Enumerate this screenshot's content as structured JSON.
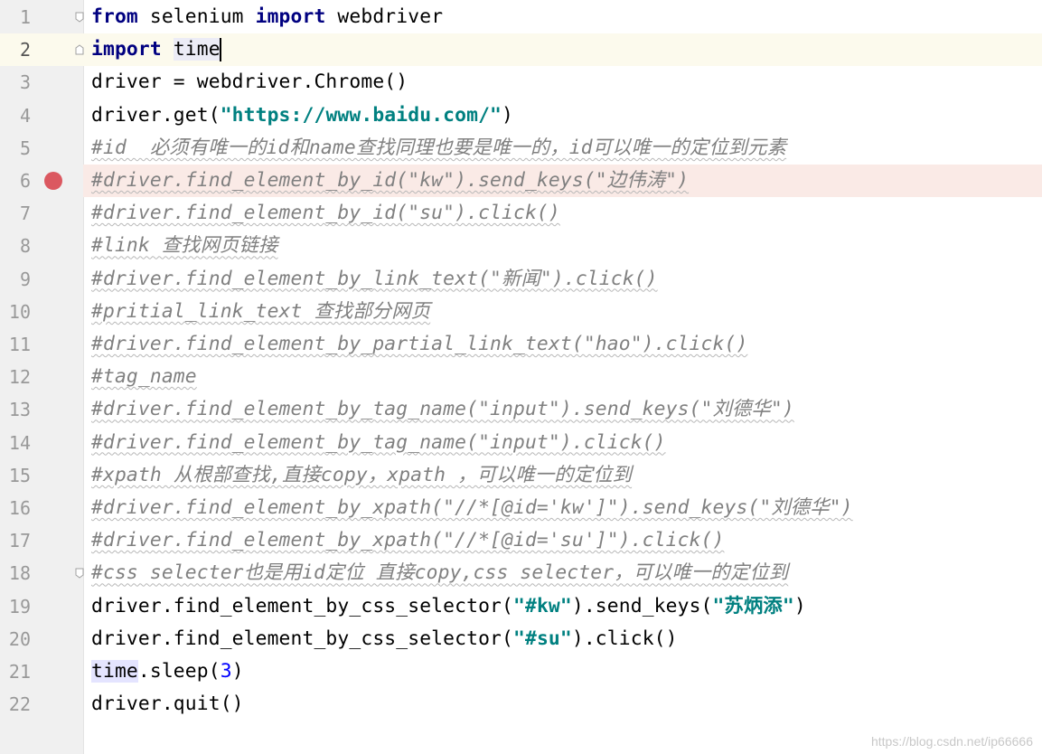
{
  "editor": {
    "current_line": 2,
    "breakpoint_line": 6,
    "lines": [
      {
        "num": "1",
        "parts": [
          [
            "kw",
            "from"
          ],
          [
            "p",
            " selenium "
          ],
          [
            "kw",
            "import"
          ],
          [
            "p",
            " webdriver"
          ]
        ]
      },
      {
        "num": "2",
        "parts": [
          [
            "kw",
            "import"
          ],
          [
            "p",
            " "
          ],
          [
            "hl2",
            "time"
          ],
          [
            "caret",
            ""
          ]
        ]
      },
      {
        "num": "3",
        "parts": [
          [
            "p",
            "driver = webdriver.Chrome()"
          ]
        ]
      },
      {
        "num": "4",
        "parts": [
          [
            "p",
            "driver.get("
          ],
          [
            "str",
            "\"https://www.baidu.com/\""
          ],
          [
            "p",
            ")"
          ]
        ]
      },
      {
        "num": "5",
        "parts": [
          [
            "cmt",
            "#id  必须有唯一的id和name查找同理也要是唯一的，id可以唯一的定位到元素"
          ]
        ]
      },
      {
        "num": "6",
        "parts": [
          [
            "cmt",
            "#driver.find_element_by_id(\"kw\").send_keys(\"边伟涛\")"
          ]
        ]
      },
      {
        "num": "7",
        "parts": [
          [
            "cmt",
            "#driver.find_element_by_id(\"su\").click()"
          ]
        ]
      },
      {
        "num": "8",
        "parts": [
          [
            "cmt",
            "#link 查找网页链接"
          ]
        ]
      },
      {
        "num": "9",
        "parts": [
          [
            "cmt",
            "#driver.find_element_by_link_text(\"新闻\").click()"
          ]
        ]
      },
      {
        "num": "10",
        "parts": [
          [
            "cmt",
            "#pritial_link_text 查找部分网页"
          ]
        ]
      },
      {
        "num": "11",
        "parts": [
          [
            "cmt",
            "#driver.find_element_by_partial_link_text(\"hao\").click()"
          ]
        ]
      },
      {
        "num": "12",
        "parts": [
          [
            "cmt",
            "#tag_name"
          ]
        ]
      },
      {
        "num": "13",
        "parts": [
          [
            "cmt",
            "#driver.find_element_by_tag_name(\"input\").send_keys(\"刘德华\")"
          ]
        ]
      },
      {
        "num": "14",
        "parts": [
          [
            "cmt",
            "#driver.find_element_by_tag_name(\"input\").click()"
          ]
        ]
      },
      {
        "num": "15",
        "parts": [
          [
            "cmt",
            "#xpath 从根部查找,直接copy，xpath ，可以唯一的定位到"
          ]
        ]
      },
      {
        "num": "16",
        "parts": [
          [
            "cmt",
            "#driver.find_element_by_xpath(\"//*[@id='kw']\").send_keys(\"刘德华\")"
          ]
        ]
      },
      {
        "num": "17",
        "parts": [
          [
            "cmt",
            "#driver.find_element_by_xpath(\"//*[@id='su']\").click()"
          ]
        ]
      },
      {
        "num": "18",
        "parts": [
          [
            "cmt",
            "#css selecter也是用id定位 直接copy,css selecter，可以唯一的定位到"
          ]
        ]
      },
      {
        "num": "19",
        "parts": [
          [
            "p",
            "driver.find_element_by_css_selector("
          ],
          [
            "str",
            "\"#kw\""
          ],
          [
            "p",
            ").send_keys("
          ],
          [
            "str",
            "\"苏炳添\""
          ],
          [
            "p",
            ")"
          ]
        ]
      },
      {
        "num": "20",
        "parts": [
          [
            "p",
            "driver.find_element_by_css_selector("
          ],
          [
            "str",
            "\"#su\""
          ],
          [
            "p",
            ").click()"
          ]
        ]
      },
      {
        "num": "21",
        "parts": [
          [
            "hl",
            "time"
          ],
          [
            "p",
            ".sleep("
          ],
          [
            "num",
            "3"
          ],
          [
            "p",
            ")"
          ]
        ]
      },
      {
        "num": "22",
        "parts": [
          [
            "p",
            "driver.quit()"
          ]
        ]
      }
    ]
  },
  "watermark": "https://blog.csdn.net/ip66666",
  "colors": {
    "keyword": "#000080",
    "string": "#008080",
    "comment": "#808080",
    "number": "#0000ff",
    "breakpoint": "#db5860",
    "current_line_bg": "#fcfaed",
    "breakpoint_line_bg": "#faeae6"
  }
}
